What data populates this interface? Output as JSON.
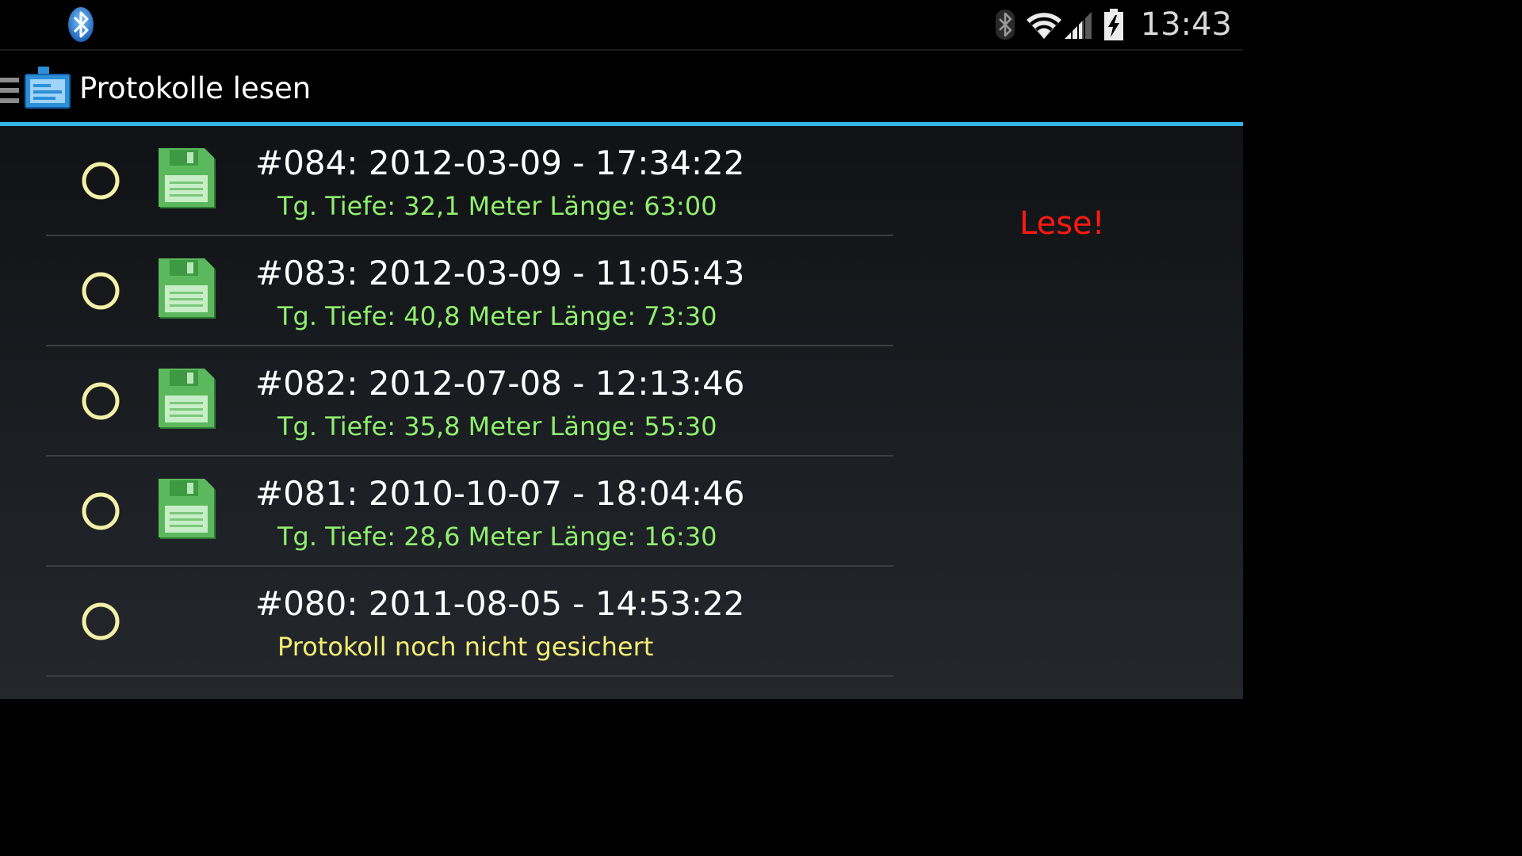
{
  "status_bar": {
    "time": "13:43",
    "icons": [
      "bluetooth-icon",
      "bluetooth-icon",
      "wifi-icon",
      "signal-icon",
      "battery-charging-icon"
    ]
  },
  "action_bar": {
    "title": "Protokolle lesen",
    "icons": [
      "drawer-menu-icon",
      "app-icon"
    ]
  },
  "log_list": {
    "items": [
      {
        "title": "#084: 2012-03-09 - 17:34:22",
        "subtitle": "Tg. Tiefe: 32,1 Meter Länge: 63:00",
        "saved": true,
        "selected": false
      },
      {
        "title": "#083: 2012-03-09 - 11:05:43",
        "subtitle": "Tg. Tiefe: 40,8 Meter Länge: 73:30",
        "saved": true,
        "selected": false
      },
      {
        "title": "#082: 2012-07-08 - 12:13:46",
        "subtitle": "Tg. Tiefe: 35,8 Meter Länge: 55:30",
        "saved": true,
        "selected": false
      },
      {
        "title": "#081: 2010-10-07 - 18:04:46",
        "subtitle": "Tg. Tiefe: 28,6 Meter Länge: 16:30",
        "saved": true,
        "selected": false
      },
      {
        "title": "#080: 2011-08-05 - 14:53:22",
        "subtitle": "Protokoll noch nicht gesichert",
        "saved": false,
        "selected": false
      }
    ]
  },
  "read_status": "Lese!",
  "colors": {
    "accent": "#33b5e5",
    "saved_subtitle": "#8fef6e",
    "pending_subtitle": "#f2ee72",
    "read_status": "#ff1a0f",
    "radio_ring": "#f3f0a8",
    "disk": "#5cb85c"
  }
}
